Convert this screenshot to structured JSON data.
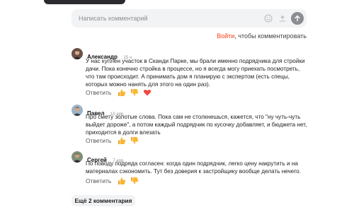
{
  "composer": {
    "placeholder": "Написать комментарий"
  },
  "login_prompt": {
    "link": "Войти",
    "text": ", чтобы комментировать"
  },
  "comments": [
    {
      "author": "Александр",
      "time": "15 ч",
      "text": "У нас куплен участок в Сканди Парке, мы брали именно подрядчика для стройки дачи. Пока конечно стройка в процессе, но я всегда могу приехать посмотреть, что там происходит. А принимать дом я планирую с экспертом (есть спецы, которых можно нанять для этого на один раз).",
      "reply_label": "Ответить",
      "reactions": [
        "thumbs-up",
        "thumbs-down",
        "heart"
      ]
    },
    {
      "author": "Павел",
      "time": "10 апр",
      "text": "Про смету золотые слова. Пока сам не столкнешься, кажется, что \"ну чуть-чуть выйдет дороже\", а потом каждый подрядчик по кусочку добавляет, и бюджета нет, приходится в долги влезать",
      "reply_label": "Ответить",
      "reactions": [
        "thumbs-up",
        "thumbs-down"
      ]
    },
    {
      "author": "Сергей",
      "time": "7 апр",
      "text": "По поводу подряда согласен: когда один подрядчик, легко цену накрутить и на материалах сэкономить. Тут без доверия к застройщику вообще делать нечего.",
      "reply_label": "Ответить",
      "reactions": [
        "thumbs-up",
        "thumbs-down"
      ]
    }
  ],
  "more_comments": "Ещё 2 комментария",
  "colors": {
    "accent": "#ff3d16",
    "reaction_yellow": "#f7b733",
    "heart": "#f2473f",
    "muted": "#8b8d92"
  }
}
